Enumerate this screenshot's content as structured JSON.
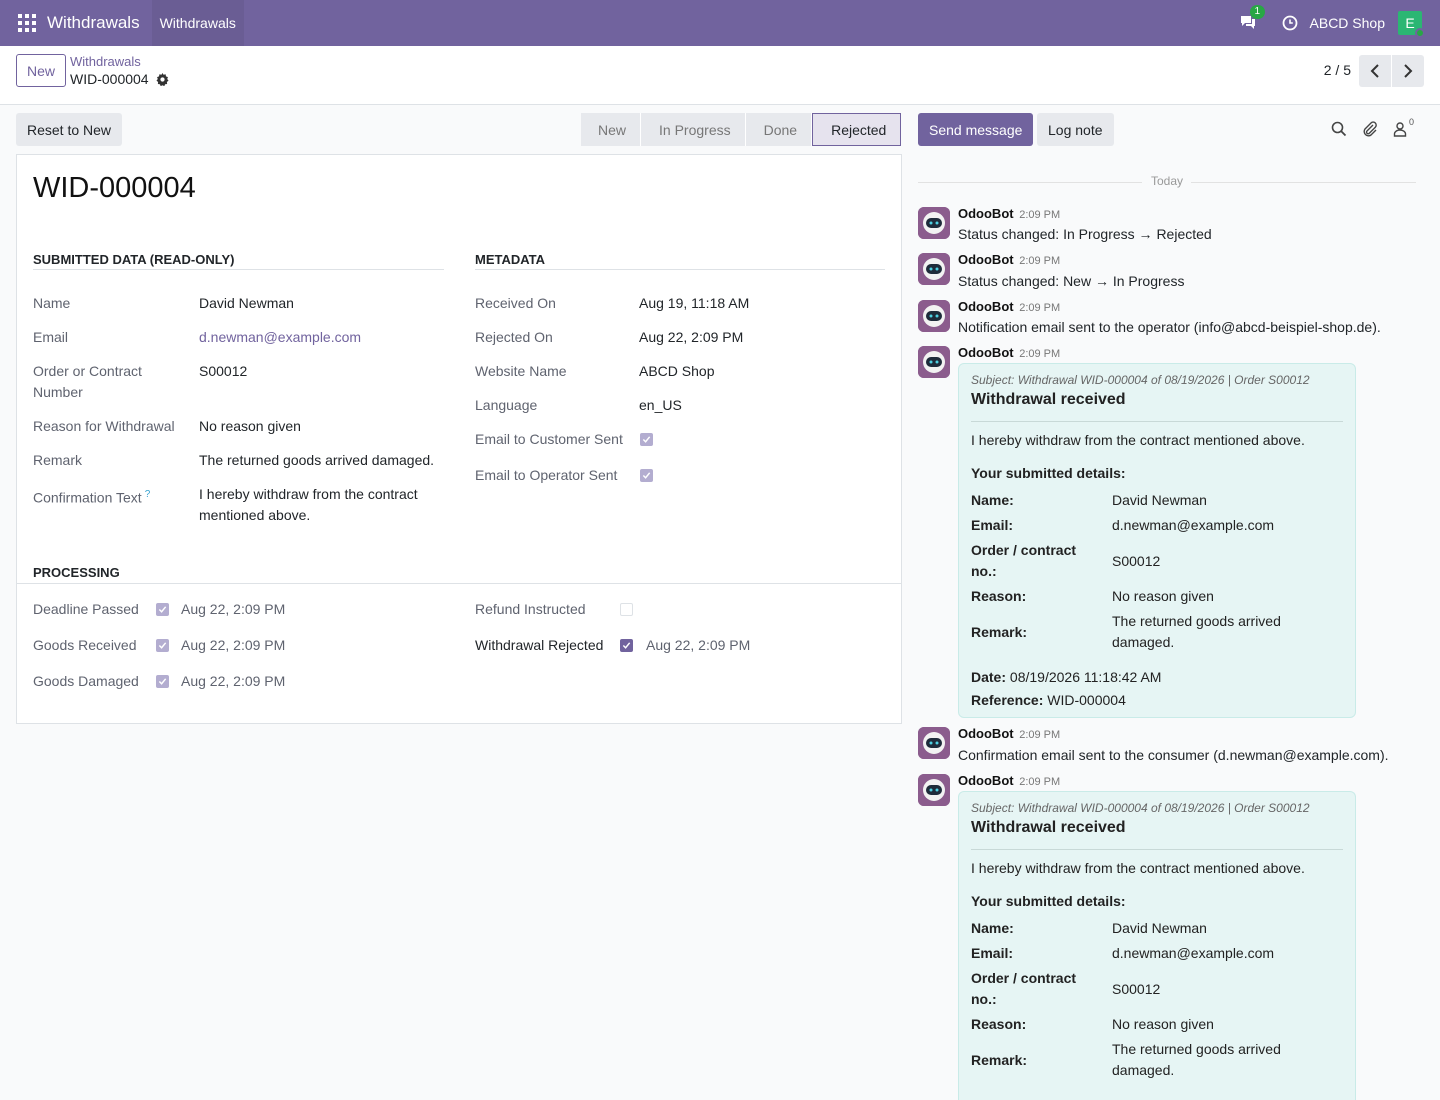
{
  "navbar": {
    "app_name": "Withdrawals",
    "menu_item": "Withdrawals",
    "chat_badge": "1",
    "company": "ABCD Shop",
    "avatar_letter": "E",
    "brand_color": "#71639e"
  },
  "control": {
    "new_label": "New",
    "breadcrumb_parent": "Withdrawals",
    "breadcrumb_current": "WID-000004",
    "pager": "2 / 5"
  },
  "statusbar": {
    "reset_label": "Reset to New",
    "stages": [
      "New",
      "In Progress",
      "Done",
      "Rejected"
    ],
    "active_stage": "Rejected"
  },
  "form": {
    "title": "WID-000004",
    "submitted": {
      "heading": "SUBMITTED DATA (READ-ONLY)",
      "name_label": "Name",
      "name": "David Newman",
      "email_label": "Email",
      "email": "d.newman@example.com",
      "order_label_1": "Order or Contract",
      "order_label_2": "Number",
      "order": "S00012",
      "reason_label": "Reason for Withdrawal",
      "reason": "No reason given",
      "remark_label": "Remark",
      "remark": "The returned goods arrived damaged.",
      "confirm_label": "Confirmation Text",
      "confirm_help": "?",
      "confirm_1": "I hereby withdraw from the contract",
      "confirm_2": "mentioned above."
    },
    "metadata": {
      "heading": "METADATA",
      "received_label": "Received On",
      "received": "Aug 19, 11:18 AM",
      "rejected_label": "Rejected On",
      "rejected": "Aug 22, 2:09 PM",
      "website_label": "Website Name",
      "website": "ABCD Shop",
      "language_label": "Language",
      "language": "en_US",
      "email_customer_label": "Email to Customer Sent",
      "email_customer_checked": true,
      "email_operator_label": "Email to Operator Sent",
      "email_operator_checked": true
    },
    "processing": {
      "heading": "PROCESSING",
      "deadline_label": "Deadline Passed",
      "deadline_date": "Aug 22, 2:09 PM",
      "received_label": "Goods Received",
      "received_date": "Aug 22, 2:09 PM",
      "damaged_label": "Goods Damaged",
      "damaged_date": "Aug 22, 2:09 PM",
      "refund_label": "Refund Instructed",
      "refund_checked": false,
      "rejected_label": "Withdrawal Rejected",
      "rejected_date": "Aug 22, 2:09 PM",
      "rejected_checked": true
    }
  },
  "chatter": {
    "send_label": "Send message",
    "log_label": "Log note",
    "followers_count": "0",
    "today": "Today",
    "author": "OdooBot",
    "time": "2:09 PM",
    "msg1": "Status changed: In Progress → Rejected",
    "msg2": "Status changed: New → In Progress",
    "msg3": "Notification email sent to the operator (info@abcd-beispiel-shop.de).",
    "msg5": "Confirmation email sent to the consumer (d.newman@example.com).",
    "mail": {
      "subject": "Subject: Withdrawal WID-000004 of 08/19/2026 | Order S00012",
      "title": "Withdrawal received",
      "intro": "I hereby withdraw from the contract mentioned above.",
      "details_heading": "Your submitted details:",
      "name_k": "Name:",
      "name_v": "David Newman",
      "email_k": "Email:",
      "email_v": "d.newman@example.com",
      "order_k1": "Order / contract",
      "order_k2": "no.:",
      "order_v": "S00012",
      "reason_k": "Reason:",
      "reason_v": "No reason given",
      "remark_k": "Remark:",
      "remark_v1": "The returned goods arrived",
      "remark_v2": "damaged.",
      "date_k": "Date:",
      "date_v": "08/19/2026 11:18:42 AM",
      "ref_k": "Reference:",
      "ref_v": "WID-000004"
    }
  }
}
